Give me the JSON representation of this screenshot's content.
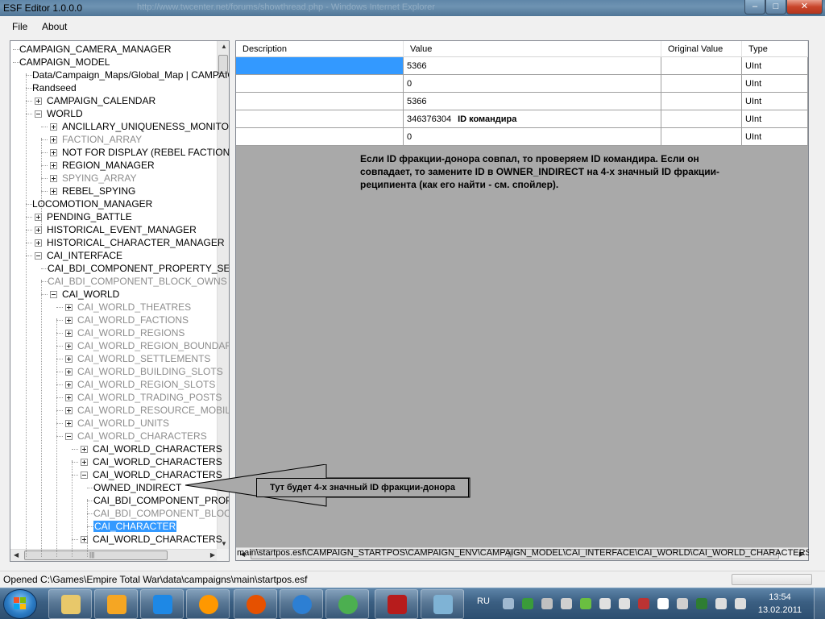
{
  "window": {
    "title": "ESF Editor 1.0.0.0",
    "background_title": "http://www.twcenter.net/forums/showthread.php - Windows Internet Explorer",
    "controls": {
      "minimize": "–",
      "maximize": "□",
      "close": "✕"
    }
  },
  "menu": {
    "file": "File",
    "about": "About"
  },
  "tree": {
    "nodes": [
      "CAMPAIGN_CAMERA_MANAGER",
      "CAMPAIGN_MODEL",
      "Data/Campaign_Maps/Global_Map | CAMPAIGN",
      "Randseed",
      "CAMPAIGN_CALENDAR",
      "WORLD",
      "ANCILLARY_UNIQUENESS_MONITOR",
      "FACTION_ARRAY",
      "NOT FOR DISPLAY (REBEL FACTION) | RE",
      "REGION_MANAGER",
      "SPYING_ARRAY",
      "REBEL_SPYING",
      "LOCOMOTION_MANAGER",
      "PENDING_BATTLE",
      "HISTORICAL_EVENT_MANAGER",
      "HISTORICAL_CHARACTER_MANAGER",
      "CAI_INTERFACE",
      "CAI_BDI_COMPONENT_PROPERTY_SET",
      "CAI_BDI_COMPONENT_BLOCK_OWNS",
      "CAI_WORLD",
      "CAI_WORLD_THEATRES",
      "CAI_WORLD_FACTIONS",
      "CAI_WORLD_REGIONS",
      "CAI_WORLD_REGION_BOUNDARIES",
      "CAI_WORLD_SETTLEMENTS",
      "CAI_WORLD_BUILDING_SLOTS",
      "CAI_WORLD_REGION_SLOTS",
      "CAI_WORLD_TRADING_POSTS",
      "CAI_WORLD_RESOURCE_MOBILES",
      "CAI_WORLD_UNITS",
      "CAI_WORLD_CHARACTERS",
      "CAI_WORLD_CHARACTERS",
      "CAI_WORLD_CHARACTERS",
      "CAI_WORLD_CHARACTERS",
      "OWNED_INDIRECT",
      "CAI_BDI_COMPONENT_PROPERTY",
      "CAI_BDI_COMPONENT_BLOCK",
      "CAI_CHARACTER",
      "CAI_WORLD_CHARACTERS"
    ],
    "scroll_grip": "|||"
  },
  "grid": {
    "columns": {
      "description": "Description",
      "value": "Value",
      "original": "Original Value",
      "type": "Type"
    },
    "rows": [
      {
        "value": "5366",
        "label": "",
        "type": "UInt"
      },
      {
        "value": "0",
        "label": "",
        "type": "UInt"
      },
      {
        "value": "5366",
        "label": "",
        "type": "UInt"
      },
      {
        "value": "346376304",
        "label": "ID командира",
        "type": "UInt"
      },
      {
        "value": "0",
        "label": "",
        "type": "UInt"
      }
    ],
    "note": "Если ID фракции-донора совпал, то проверяем ID командира. Если он совпадает, то замените ID в OWNER_INDIRECT на 4-х значный ID фракции-реципиента (как его найти - см. спойлер).",
    "scroll_grip": "|||"
  },
  "path": "main\\startpos.esf\\CAMPAIGN_STARTPOS\\CAMPAIGN_ENV\\CAMPAIGN_MODEL\\CAI_INTERFACE\\CAI_WORLD\\CAI_WORLD_CHARACTERS\\",
  "callout": "Тут будет 4-х значный ID фракции-донора",
  "status": "Opened C:\\Games\\Empire Total War\\data\\campaigns\\main\\startpos.esf",
  "taskbar": {
    "lang": "RU",
    "time": "13:54",
    "date": "13.02.2011",
    "apps": [
      "explorer-folder",
      "media-player",
      "internet-explorer",
      "mail-agent",
      "firefox",
      "safari",
      "icq",
      "flash-app",
      "paint"
    ]
  },
  "colors": {
    "selection": "#3399ff",
    "grid_bg": "#a9a9a9",
    "taskbar": "#3b5f82"
  }
}
